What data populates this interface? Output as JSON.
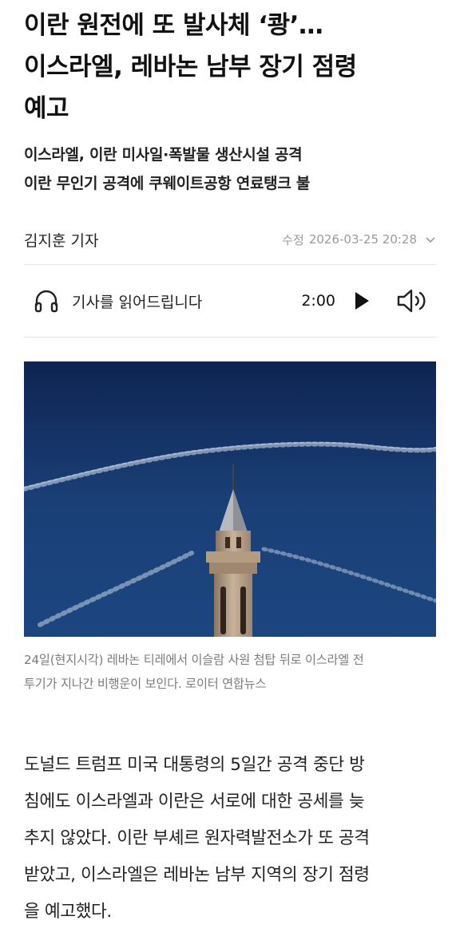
{
  "article": {
    "headline_lines": [
      "이란 원전에 또 발사체 ‘쾅’…",
      "이스라엘, 레바논 남부 장기 점령",
      "예고"
    ],
    "subhead_lines": [
      "이스라엘, 이란 미사일·폭발물 생산시설 공격",
      "이란 무인기 공격에 쿠웨이트공항 연료탱크 불"
    ],
    "reporter": "김지훈 기자",
    "modified_label": "수정",
    "modified_datetime": "2026-03-25 20:28",
    "caption_lines": [
      "24일(현지시각) 레바논 티레에서 이슬람 사원 첨탑 뒤로 이스라엘 전",
      "투기가 지나간 비행운이 보인다. 로이터 연합뉴스"
    ],
    "body_lines": [
      "도널드 트럼프 미국 대통령의 5일간 공격 중단 방",
      "침에도 이스라엘과 이란은 서로에 대한 공세를 늦",
      "추지 않았다. 이란 부셰르 원자력발전소가 또 공격",
      "받았고, 이스라엘은 레바논 남부 지역의 장기 점령",
      "을 예고했다."
    ]
  },
  "tts": {
    "label": "기사를 읽어드립니다",
    "duration": "2:00"
  },
  "icons": {
    "headphones": "headphones-icon",
    "play": "play-icon",
    "volume": "volume-icon",
    "expand": "chevron-down-icon"
  },
  "colors": {
    "text": "#111111",
    "muted": "#9a9a9a",
    "caption": "#7b7b7b",
    "sky": "#1a3f76"
  }
}
